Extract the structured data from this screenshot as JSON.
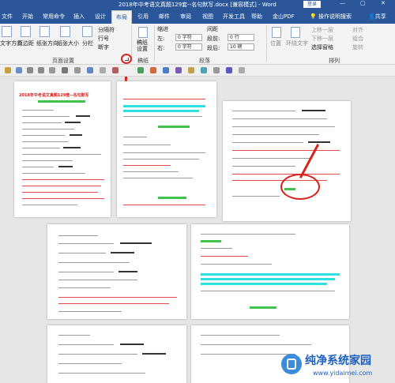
{
  "window": {
    "title": "2018年中考语文真题129套--名句默写.docx [兼容模式] - Word",
    "login": "登录",
    "min": "—",
    "max": "▢",
    "close": "✕"
  },
  "tabs": [
    {
      "label": "文件"
    },
    {
      "label": "开始"
    },
    {
      "label": "常用命令"
    },
    {
      "label": "插入"
    },
    {
      "label": "设计"
    },
    {
      "label": "布局"
    },
    {
      "label": "引用"
    },
    {
      "label": "邮件"
    },
    {
      "label": "审阅"
    },
    {
      "label": "视图"
    },
    {
      "label": "开发工具"
    },
    {
      "label": "帮助"
    },
    {
      "label": "金山PDF"
    }
  ],
  "tell_me": "操作说明搜索",
  "share": "共享",
  "ribbon": {
    "text_direction": "文字方向",
    "margins": "页边距",
    "orientation": "纸张方向",
    "size": "纸张大小",
    "columns": "分栏",
    "breaks": "分隔符",
    "line_numbers": "行号",
    "hyphenation": "断字",
    "page_setup_group": "页面设置",
    "draft": "稿纸设置",
    "draft_group": "稿纸",
    "indent_label": "缩进",
    "spacing_label": "间距",
    "left_label": "左:",
    "right_label": "右:",
    "before_label": "段前:",
    "after_label": "段后:",
    "indent_left": "0 字符",
    "indent_right": "0 字符",
    "space_before": "0 行",
    "space_after": "10 磅",
    "paragraph_group": "段落",
    "position": "位置",
    "wrap": "环绕文字",
    "forward": "上移一层",
    "backward": "下移一层",
    "selection_pane": "选择窗格",
    "align": "对齐",
    "group": "组合",
    "rotate": "旋转",
    "arrange_group": "排列"
  },
  "doc": {
    "page1_title": "2018年中考语文真题129套--名句默写"
  },
  "watermark": {
    "brand": "纯净系统家园",
    "url": "www.yidaimei.com"
  },
  "colors": {
    "title_bar": "#2b579a",
    "highlight_cyan": "#2ee0e0",
    "highlight_green": "#3fc34a",
    "annotation_red": "#d8231f"
  }
}
